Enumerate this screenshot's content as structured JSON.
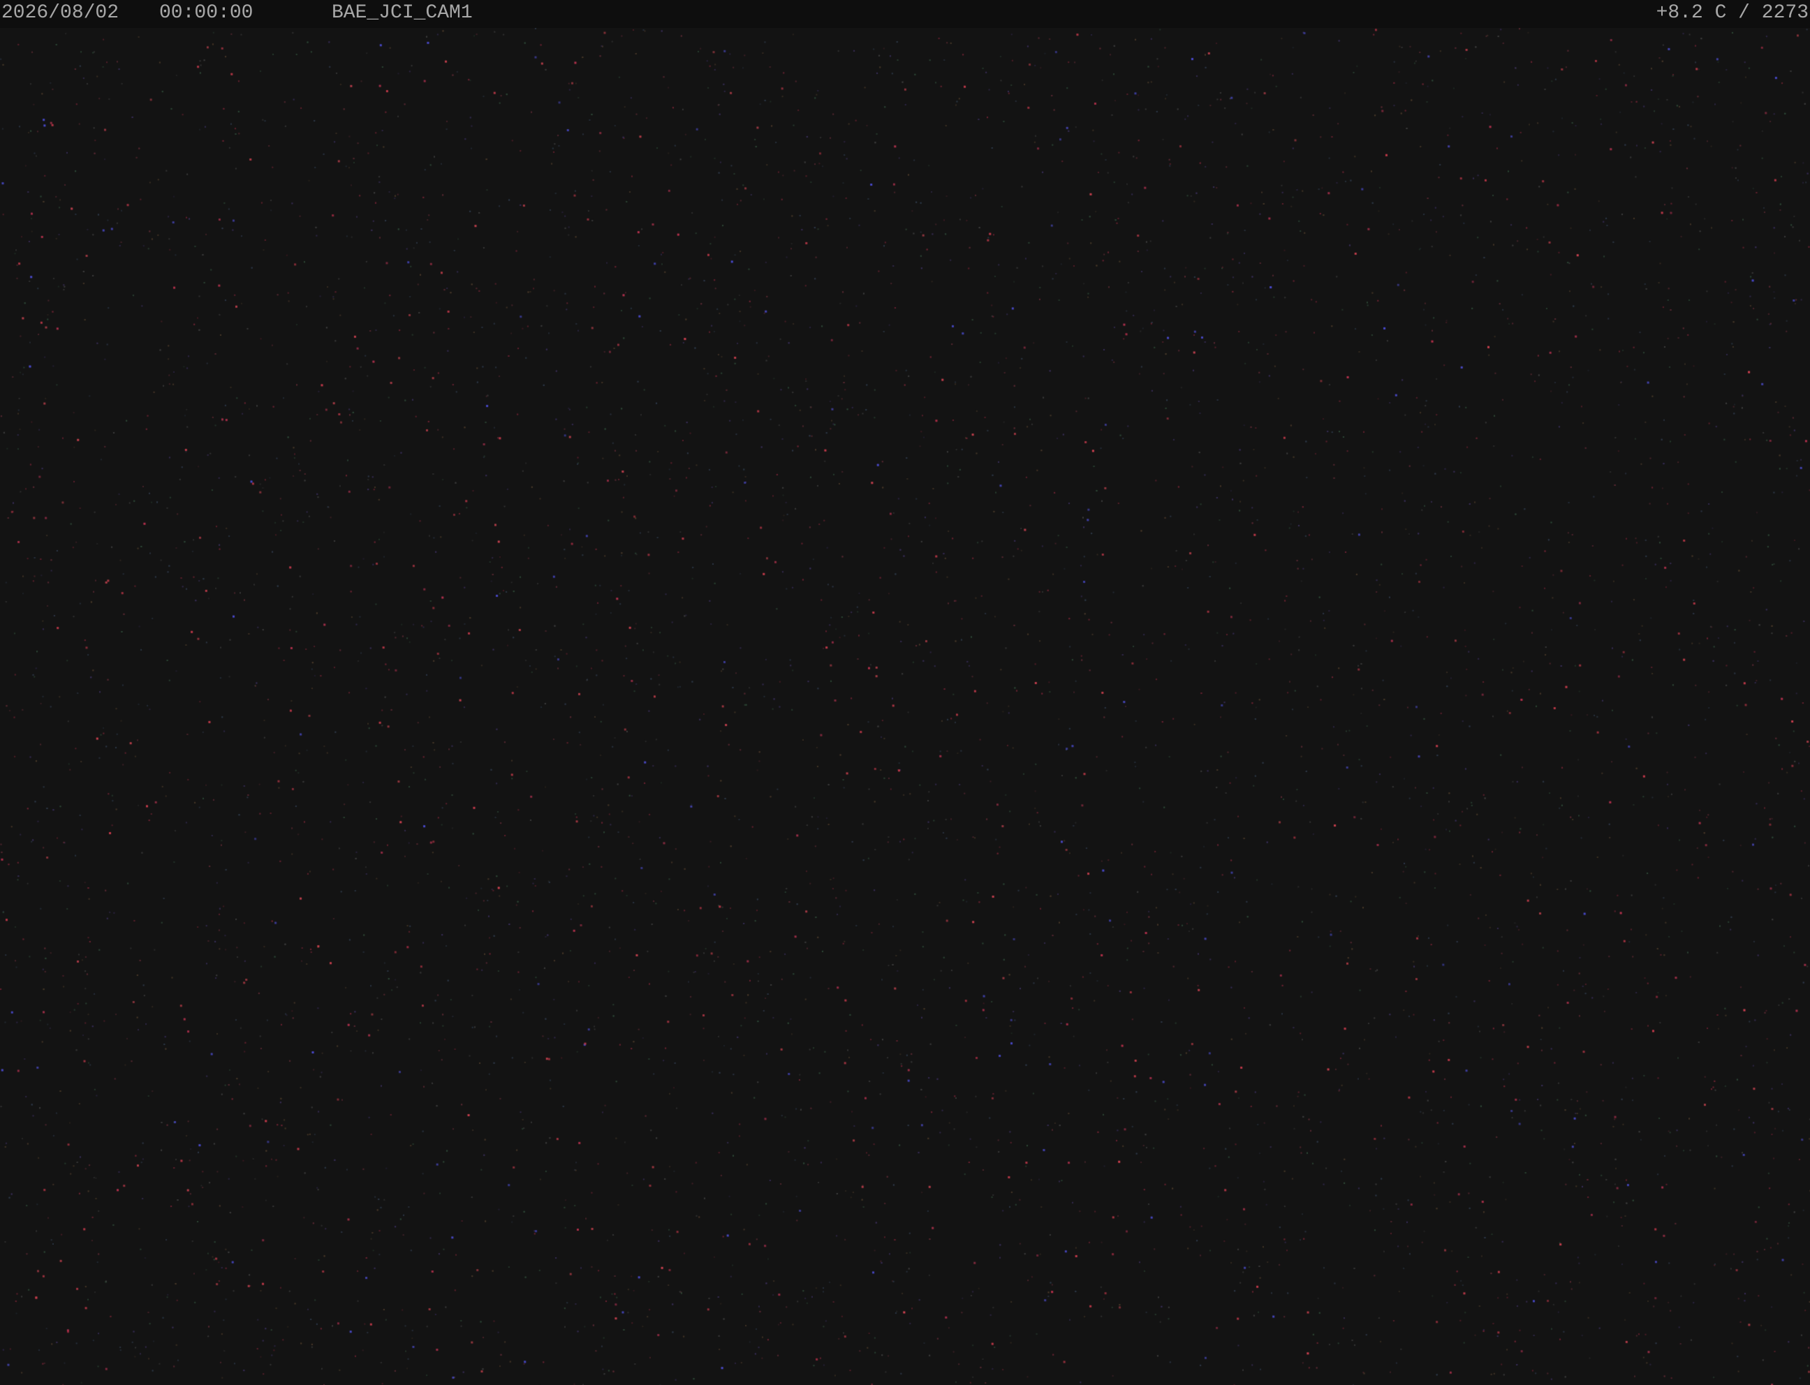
{
  "osd": {
    "date": "2026/08/02",
    "time": "00:00:00",
    "camera_name": "BAE_JCI_CAM1",
    "status": "+8.2 C / 2273"
  },
  "colors": {
    "background": "#131313",
    "osd_bar": "#0e0e0e",
    "osd_text": "#a8a8a8"
  }
}
